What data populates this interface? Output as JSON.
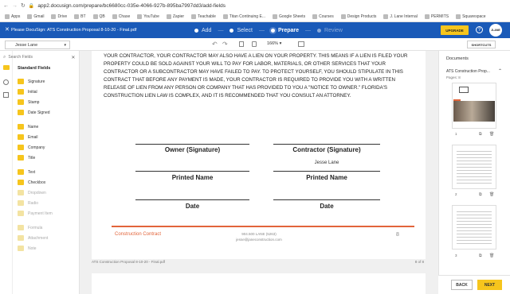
{
  "browser": {
    "url": "app2.docusign.com/prepare/bc6680cc-035e-4066-927b-895ba7997dd3/add-fields",
    "bookmarks": [
      "Apps",
      "Gmail",
      "Drive",
      "BT",
      "QB",
      "Chase",
      "YouTube",
      "Zapier",
      "Teachable",
      "Titan Continuing E...",
      "Google Sheets",
      "Courses",
      "Design Products",
      "J. Lane Internal",
      "PERMITS",
      "Squarespace"
    ]
  },
  "header": {
    "title": "Please DocuSign: ATS Construction Proposal 8-10-20 - Final.pdf",
    "steps": [
      {
        "label": "Add"
      },
      {
        "label": "Select"
      },
      {
        "label": "Prepare"
      },
      {
        "label": "Review"
      }
    ],
    "upgrade_label": "UPGRADE",
    "logo_text": "JLANE",
    "close_glyph": "✕",
    "help_glyph": "?"
  },
  "toolbar": {
    "recipient": "Jesse Lane",
    "zoom": "166%",
    "shortcuts_label": "SHORTCUTS"
  },
  "left_panel": {
    "search_placeholder": "Search Fields",
    "section_title": "Standard Fields",
    "groups": [
      [
        {
          "label": "Signature",
          "color": "#f6c51d"
        },
        {
          "label": "Initial",
          "color": "#f6c51d"
        },
        {
          "label": "Stamp",
          "color": "#f6c51d"
        },
        {
          "label": "Date Signed",
          "color": "#f6c51d"
        }
      ],
      [
        {
          "label": "Name",
          "color": "#f6c51d"
        },
        {
          "label": "Email",
          "color": "#f6c51d"
        },
        {
          "label": "Company",
          "color": "#f6c51d"
        },
        {
          "label": "Title",
          "color": "#f6c51d"
        }
      ],
      [
        {
          "label": "Text",
          "color": "#f6c51d"
        },
        {
          "label": "Checkbox",
          "color": "#f6c51d"
        },
        {
          "label": "Dropdown",
          "color": "#f3e3a2"
        },
        {
          "label": "Radio",
          "color": "#f3e3a2"
        },
        {
          "label": "Payment Item",
          "color": "#f3e3a2"
        }
      ],
      [
        {
          "label": "Formula",
          "color": "#f3e3a2"
        },
        {
          "label": "Attachment",
          "color": "#f3e3a2"
        },
        {
          "label": "Note",
          "color": "#f3e3a2"
        }
      ]
    ]
  },
  "document": {
    "paragraph": "YOUR CONTRACTOR, YOUR CONTRACTOR MAY ALSO HAVE A LIEN ON YOUR PROPERTY. THIS MEANS IF A LIEN IS FILED YOUR PROPERTY COULD BE SOLD AGAINST YOUR WILL TO PAY FOR LABOR, MATERIALS, OR OTHER SERVICES THAT YOUR CONTRACTOR OR A SUBCONTRACTOR MAY HAVE FAILED TO PAY. TO PROTECT YOURSELF, YOU SHOULD STIPULATE IN THIS CONTRACT THAT BEFORE ANY PAYMENT IS MADE, YOUR CONTRACTOR IS REQUIRED TO PROVIDE YOU WITH A WRITTEN RELEASE OF LIEN FROM ANY PERSON OR COMPANY THAT HAS PROVIDED TO YOU A \"NOTICE TO OWNER.\" FLORIDA'S CONSTRUCTION LIEN LAW IS COMPLEX, AND IT IS RECOMMENDED THAT YOU CONSULT AN ATTORNEY.",
    "owner_sig": "Owner (Signature)",
    "contractor_sig": "Contractor (Signature)",
    "contractor_name": "Jesse Lane",
    "printed_name_left": "Printed Name",
    "printed_name_right": "Printed Name",
    "date_left": "Date",
    "date_right": "Date",
    "footer_left": "Construction Contract",
    "footer_center_line1": "904.500 LANE (5263)",
    "footer_center_line2": "jesse@janeconstruction.com",
    "page_number": "8",
    "filename": "ATS Construction Proposal 8-10-20 - Final.pdf",
    "page_of": "8 of 8"
  },
  "right_panel": {
    "title": "Documents",
    "doc_name": "ATS Construction Prop...",
    "pages": "Pages: 8",
    "thumb_numbers": [
      "1",
      "2",
      "3"
    ]
  },
  "footer_buttons": {
    "back": "BACK",
    "next": "NEXT"
  }
}
